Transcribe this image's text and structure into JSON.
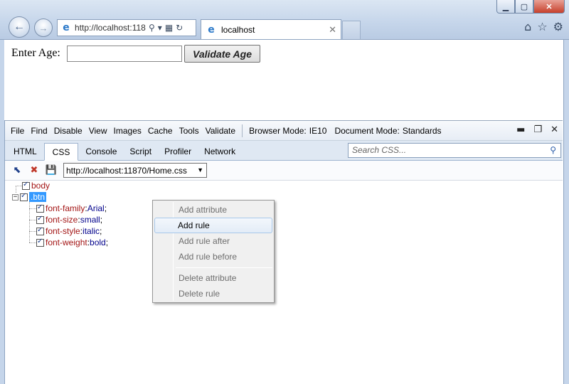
{
  "browser": {
    "address_url": "http://localhost:118",
    "tab_title": "localhost"
  },
  "page": {
    "age_label": "Enter Age:",
    "age_input_value": "",
    "validate_button": "Validate Age"
  },
  "devtools": {
    "menu": [
      "File",
      "Find",
      "Disable",
      "View",
      "Images",
      "Cache",
      "Tools",
      "Validate"
    ],
    "browser_mode_label": "Browser Mode:",
    "browser_mode_value": "IE10",
    "document_mode_label": "Document Mode:",
    "document_mode_value": "Standards",
    "tabs": [
      "HTML",
      "CSS",
      "Console",
      "Script",
      "Profiler",
      "Network"
    ],
    "active_tab": "CSS",
    "search_placeholder": "Search CSS...",
    "stylesheet": "http://localhost:11870/Home.css",
    "rules": [
      {
        "selector": "body"
      },
      {
        "selector": ".btn",
        "properties": [
          {
            "name": "font-family",
            "value": "Arial"
          },
          {
            "name": "font-size",
            "value": "small"
          },
          {
            "name": "font-style",
            "value": "italic"
          },
          {
            "name": "font-weight",
            "value": "bold"
          }
        ]
      }
    ]
  },
  "context_menu": {
    "items": [
      {
        "label": "Add attribute",
        "enabled": false
      },
      {
        "label": "Add rule",
        "enabled": true
      },
      {
        "label": "Add rule after",
        "enabled": false
      },
      {
        "label": "Add rule before",
        "enabled": false
      },
      {
        "label": "Delete attribute",
        "enabled": false
      },
      {
        "label": "Delete rule",
        "enabled": false
      }
    ]
  }
}
